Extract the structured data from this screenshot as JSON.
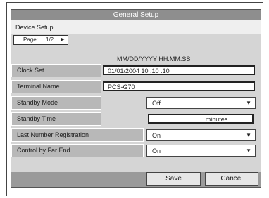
{
  "window": {
    "title": "General Setup"
  },
  "header": {
    "section": "Device Setup"
  },
  "pager": {
    "label": "Page:",
    "value": "1/2"
  },
  "format_hint": "MM/DD/YYYY HH:MM:SS",
  "fields": {
    "clock": {
      "label": "Clock Set",
      "value": "01/01/2004 10 :10 :10"
    },
    "terminal": {
      "label": "Terminal Name",
      "value": "PCS-G70"
    },
    "standby_mode": {
      "label": "Standby Mode",
      "value": "Off"
    },
    "standby_time": {
      "label": "Standby Time",
      "value": "minutes"
    },
    "last_number": {
      "label": "Last Number Registration",
      "value": "On"
    },
    "far_end": {
      "label": "Control by Far End",
      "value": "On"
    }
  },
  "buttons": {
    "save": "Save",
    "cancel": "Cancel"
  },
  "icons": {
    "pager_next": "triangle-right-icon",
    "dropdown": "chevron-down-icon"
  }
}
